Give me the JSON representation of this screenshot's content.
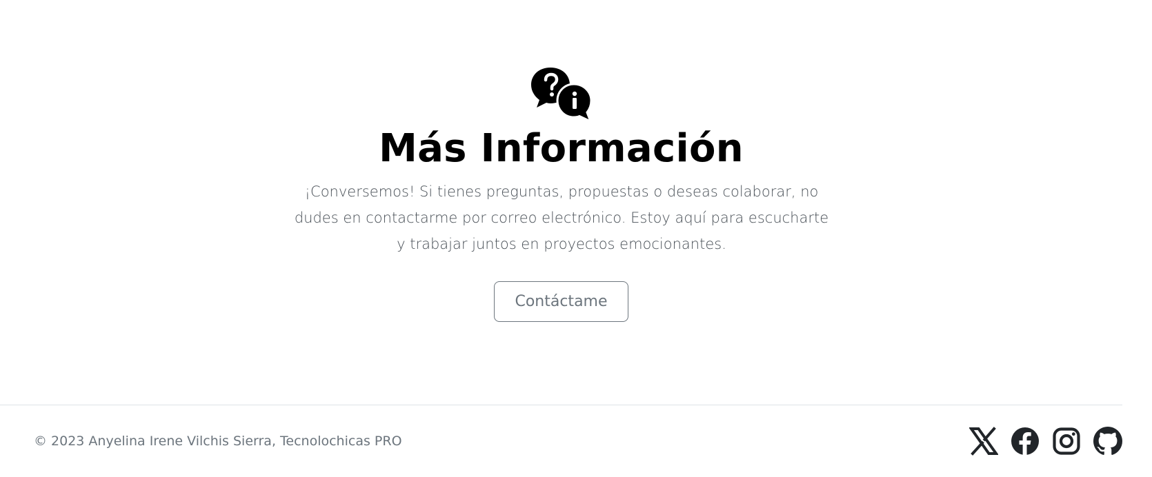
{
  "hero": {
    "icon": "question-info-chat-bubbles-icon",
    "title": "Más Información",
    "lead_line_1": "¡Conversemos! Si tienes preguntas, propuestas o deseas colaborar, no",
    "lead_line_2": "dudes en contactarme por correo electrónico. Estoy aquí para escucharte",
    "lead_line_3": "y trabajar juntos en proyectos emocionantes.",
    "button_label": "Contáctame"
  },
  "footer": {
    "copyright": "© 2023 Anyelina Irene Vilchis Sierra, Tecnolochicas PRO",
    "social": [
      {
        "icon": "x-twitter-icon"
      },
      {
        "icon": "facebook-icon"
      },
      {
        "icon": "instagram-icon"
      },
      {
        "icon": "github-icon"
      }
    ]
  },
  "colors": {
    "title": "#000000",
    "lead_text": "#495057",
    "button_outline": "#6c757d",
    "footer_text": "#6c757d",
    "divider": "#dee2e6",
    "icons": "#212529"
  }
}
